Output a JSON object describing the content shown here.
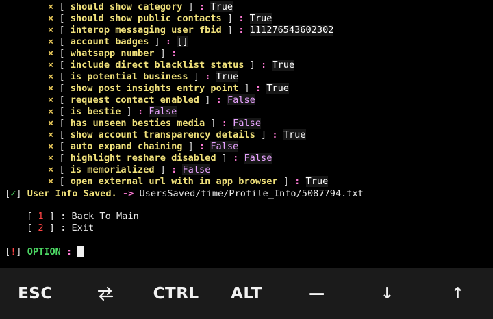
{
  "terminal": {
    "properties": [
      {
        "marker": "×",
        "key": "should show category",
        "value": "True"
      },
      {
        "marker": "×",
        "key": "should show public contacts",
        "value": "True"
      },
      {
        "marker": "×",
        "key": "interop messaging user fbid",
        "value": "111276543602302"
      },
      {
        "marker": "×",
        "key": "account badges",
        "value": "[]"
      },
      {
        "marker": "×",
        "key": "whatsapp number",
        "value": ""
      },
      {
        "marker": "×",
        "key": "include direct blacklist status",
        "value": "True"
      },
      {
        "marker": "×",
        "key": "is potential business",
        "value": "True"
      },
      {
        "marker": "×",
        "key": "show post insights entry point",
        "value": "True"
      },
      {
        "marker": "×",
        "key": "request contact enabled",
        "value": "False"
      },
      {
        "marker": "×",
        "key": "is bestie",
        "value": "False"
      },
      {
        "marker": "×",
        "key": "has unseen besties media",
        "value": "False"
      },
      {
        "marker": "×",
        "key": "show account transparency details",
        "value": "True"
      },
      {
        "marker": "×",
        "key": "auto expand chaining",
        "value": "False"
      },
      {
        "marker": "×",
        "key": "highlight reshare disabled",
        "value": "False"
      },
      {
        "marker": "×",
        "key": "is memorialized",
        "value": "False"
      },
      {
        "marker": "×",
        "key": "open external url with in app browser",
        "value": "True"
      }
    ],
    "saved": {
      "check": "✓",
      "message": "User Info Saved.",
      "arrow": "->",
      "path": "UsersSaved/time/Profile_Info/5087794.txt"
    },
    "menu": [
      {
        "num": "1",
        "label": "Back To Main"
      },
      {
        "num": "2",
        "label": "Exit"
      }
    ],
    "prompt": {
      "mark": "!",
      "label": "OPTION"
    }
  },
  "extra_keys": [
    {
      "label": "ESC",
      "icon": null
    },
    {
      "label": "",
      "icon": "swap-arrows-icon"
    },
    {
      "label": "CTRL",
      "icon": null
    },
    {
      "label": "ALT",
      "icon": null
    },
    {
      "label": "—",
      "icon": null
    },
    {
      "label": "↓",
      "icon": null
    },
    {
      "label": "↑",
      "icon": null
    }
  ]
}
